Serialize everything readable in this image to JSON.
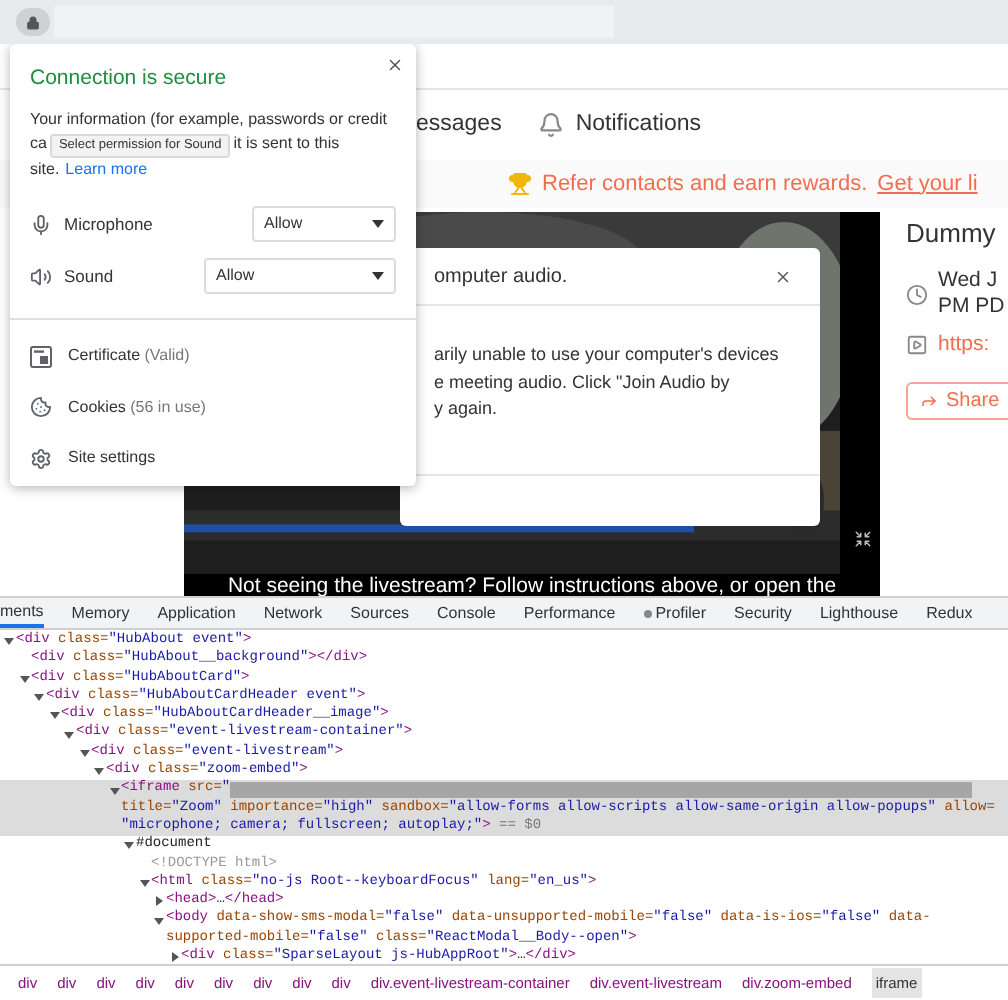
{
  "page": {
    "nav": [
      {
        "kind": "plain",
        "label": "essages"
      },
      {
        "kind": "bell",
        "label": "Notifications"
      }
    ],
    "banner": {
      "text": "Refer contacts and earn rewards.",
      "link": "Get your li"
    },
    "audio_modal": {
      "title": "omputer audio.",
      "body_lines": [
        "arily unable to use your computer's devices",
        "e meeting audio. Click \"Join Audio by",
        "y again."
      ]
    },
    "video": {
      "caption": "Not seeing the livestream? Follow instructions above, or open the"
    },
    "event": {
      "title": "Dummy",
      "date_lines": [
        "Wed J",
        "PM PD"
      ],
      "link": "https:",
      "share": "Share"
    }
  },
  "site_info_popup": {
    "title": "Connection is secure",
    "description": {
      "line_1": "Your information (for example, passwords or credit",
      "line_2_start": "ca",
      "line_2_end": "it is sent to this",
      "line_3": "site."
    },
    "learn_more": "Learn more",
    "tooltip": "Select permission for Sound",
    "permissions": [
      {
        "kind": "microphone",
        "label": "Microphone",
        "value": "Allow"
      },
      {
        "kind": "sound",
        "label": "Sound",
        "value": "Allow"
      }
    ],
    "items": [
      {
        "kind": "certificate",
        "label": "Certificate",
        "detail": "(Valid)"
      },
      {
        "kind": "cookies",
        "label": "Cookies",
        "detail": "(56 in use)"
      },
      {
        "kind": "settings",
        "label": "Site settings"
      }
    ]
  },
  "devtools": {
    "tabs": [
      {
        "kind": "plain",
        "label": "ments",
        "selected": true
      },
      {
        "kind": "plain",
        "label": "Memory",
        "selected": false
      },
      {
        "kind": "plain",
        "label": "Application",
        "selected": false
      },
      {
        "kind": "plain",
        "label": "Network",
        "selected": false
      },
      {
        "kind": "plain",
        "label": "Sources",
        "selected": false
      },
      {
        "kind": "plain",
        "label": "Console",
        "selected": false
      },
      {
        "kind": "plain",
        "label": "Performance",
        "selected": false
      },
      {
        "kind": "extension",
        "label": "Profiler",
        "selected": false
      },
      {
        "kind": "plain",
        "label": "Security",
        "selected": false
      },
      {
        "kind": "plain",
        "label": "Lighthouse",
        "selected": false
      },
      {
        "kind": "plain",
        "label": "Redux",
        "selected": false
      }
    ],
    "tree": [
      {
        "kind": "node",
        "expanded": true,
        "selected": false,
        "lines": [
          [
            {
              "kind": "tag",
              "text": "<div "
            },
            {
              "kind": "attr",
              "text": "class="
            },
            {
              "kind": "value",
              "text": "\"HubAbout event\""
            },
            {
              "kind": "tag",
              "text": ">"
            }
          ]
        ],
        "children": [
          {
            "kind": "leaf",
            "selected": false,
            "lines": [
              [
                {
                  "kind": "tag",
                  "text": "<div "
                },
                {
                  "kind": "attr",
                  "text": "class="
                },
                {
                  "kind": "value",
                  "text": "\"HubAbout__background\""
                },
                {
                  "kind": "tag",
                  "text": "></div>"
                }
              ]
            ]
          },
          {
            "kind": "node",
            "expanded": true,
            "selected": false,
            "lines": [
              [
                {
                  "kind": "tag",
                  "text": "<div "
                },
                {
                  "kind": "attr",
                  "text": "class="
                },
                {
                  "kind": "value",
                  "text": "\"HubAboutCard\""
                },
                {
                  "kind": "tag",
                  "text": ">"
                }
              ]
            ],
            "children": [
              {
                "kind": "node",
                "expanded": true,
                "selected": false,
                "lines": [
                  [
                    {
                      "kind": "tag",
                      "text": "<div "
                    },
                    {
                      "kind": "attr",
                      "text": "class="
                    },
                    {
                      "kind": "value",
                      "text": "\"HubAboutCardHeader event\""
                    },
                    {
                      "kind": "tag",
                      "text": ">"
                    }
                  ]
                ],
                "children": [
                  {
                    "kind": "node",
                    "expanded": true,
                    "selected": false,
                    "lines": [
                      [
                        {
                          "kind": "tag",
                          "text": "<div "
                        },
                        {
                          "kind": "attr",
                          "text": "class="
                        },
                        {
                          "kind": "value",
                          "text": "\"HubAboutCardHeader__image\""
                        },
                        {
                          "kind": "tag",
                          "text": ">"
                        }
                      ]
                    ],
                    "children": [
                      {
                        "kind": "node",
                        "expanded": true,
                        "selected": false,
                        "lines": [
                          [
                            {
                              "kind": "tag",
                              "text": "<div "
                            },
                            {
                              "kind": "attr",
                              "text": "class="
                            },
                            {
                              "kind": "value",
                              "text": "\"event-livestream-container\""
                            },
                            {
                              "kind": "tag",
                              "text": ">"
                            }
                          ]
                        ],
                        "children": [
                          {
                            "kind": "node",
                            "expanded": true,
                            "selected": false,
                            "lines": [
                              [
                                {
                                  "kind": "tag",
                                  "text": "<div "
                                },
                                {
                                  "kind": "attr",
                                  "text": "class="
                                },
                                {
                                  "kind": "value",
                                  "text": "\"event-livestream\""
                                },
                                {
                                  "kind": "tag",
                                  "text": ">"
                                }
                              ]
                            ],
                            "children": [
                              {
                                "kind": "node",
                                "expanded": true,
                                "selected": false,
                                "lines": [
                                  [
                                    {
                                      "kind": "tag",
                                      "text": "<div "
                                    },
                                    {
                                      "kind": "attr",
                                      "text": "class="
                                    },
                                    {
                                      "kind": "value",
                                      "text": "\"zoom-embed\""
                                    },
                                    {
                                      "kind": "tag",
                                      "text": ">"
                                    }
                                  ]
                                ],
                                "children": [
                                  {
                                    "kind": "node",
                                    "expanded": true,
                                    "selected": true,
                                    "lines": [
                                      [
                                        {
                                          "kind": "tag",
                                          "text": "<iframe "
                                        },
                                        {
                                          "kind": "attr",
                                          "text": "src="
                                        },
                                        {
                                          "kind": "value",
                                          "text": "\""
                                        },
                                        {
                                          "kind": "redacted"
                                        }
                                      ],
                                      [
                                        {
                                          "kind": "attr",
                                          "text": "title="
                                        },
                                        {
                                          "kind": "value",
                                          "text": "\"Zoom\" "
                                        },
                                        {
                                          "kind": "attr",
                                          "text": "importance="
                                        },
                                        {
                                          "kind": "value",
                                          "text": "\"high\" "
                                        },
                                        {
                                          "kind": "attr",
                                          "text": "sandbox="
                                        },
                                        {
                                          "kind": "value",
                                          "text": "\"allow-forms allow-scripts allow-same-origin allow-popups\" "
                                        },
                                        {
                                          "kind": "attr",
                                          "text": "allow="
                                        }
                                      ],
                                      [
                                        {
                                          "kind": "value",
                                          "text": "\"microphone; camera; fullscreen; autoplay;\""
                                        },
                                        {
                                          "kind": "tag",
                                          "text": ">"
                                        },
                                        {
                                          "kind": "muted",
                                          "text": " == $0"
                                        }
                                      ]
                                    ],
                                    "children": [
                                      {
                                        "kind": "node",
                                        "expanded": true,
                                        "selected": false,
                                        "lines": [
                                          [
                                            {
                                              "kind": "plain",
                                              "text": "#document"
                                            }
                                          ]
                                        ],
                                        "children": [
                                          {
                                            "kind": "leaf",
                                            "selected": false,
                                            "lines": [
                                              [
                                                {
                                                  "kind": "comment",
                                                  "text": "<!DOCTYPE html>"
                                                }
                                              ]
                                            ]
                                          },
                                          {
                                            "kind": "node",
                                            "expanded": true,
                                            "selected": false,
                                            "lines": [
                                              [
                                                {
                                                  "kind": "tag",
                                                  "text": "<html "
                                                },
                                                {
                                                  "kind": "attr",
                                                  "text": "class="
                                                },
                                                {
                                                  "kind": "value",
                                                  "text": "\"no-js Root--keyboardFocus\" "
                                                },
                                                {
                                                  "kind": "attr",
                                                  "text": "lang="
                                                },
                                                {
                                                  "kind": "value",
                                                  "text": "\"en_us\""
                                                },
                                                {
                                                  "kind": "tag",
                                                  "text": ">"
                                                }
                                              ]
                                            ],
                                            "children": [
                                              {
                                                "kind": "node",
                                                "expanded": false,
                                                "selected": false,
                                                "lines": [
                                                  [
                                                    {
                                                      "kind": "tag",
                                                      "text": "<head>"
                                                    },
                                                    {
                                                      "kind": "plain",
                                                      "text": "…"
                                                    },
                                                    {
                                                      "kind": "tag",
                                                      "text": "</head>"
                                                    }
                                                  ]
                                                ]
                                              },
                                              {
                                                "kind": "node",
                                                "expanded": true,
                                                "selected": false,
                                                "lines": [
                                                  [
                                                    {
                                                      "kind": "tag",
                                                      "text": "<body "
                                                    },
                                                    {
                                                      "kind": "attr",
                                                      "text": "data-show-sms-modal="
                                                    },
                                                    {
                                                      "kind": "value",
                                                      "text": "\"false\" "
                                                    },
                                                    {
                                                      "kind": "attr",
                                                      "text": "data-unsupported-mobile="
                                                    },
                                                    {
                                                      "kind": "value",
                                                      "text": "\"false\" "
                                                    },
                                                    {
                                                      "kind": "attr",
                                                      "text": "data-is-ios="
                                                    },
                                                    {
                                                      "kind": "value",
                                                      "text": "\"false\" "
                                                    },
                                                    {
                                                      "kind": "attr",
                                                      "text": "data-"
                                                    }
                                                  ],
                                                  [
                                                    {
                                                      "kind": "attr",
                                                      "text": "supported-mobile="
                                                    },
                                                    {
                                                      "kind": "value",
                                                      "text": "\"false\" "
                                                    },
                                                    {
                                                      "kind": "attr",
                                                      "text": "class="
                                                    },
                                                    {
                                                      "kind": "value",
                                                      "text": "\"ReactModal__Body--open\""
                                                    },
                                                    {
                                                      "kind": "tag",
                                                      "text": ">"
                                                    }
                                                  ]
                                                ],
                                                "children": [
                                                  {
                                                    "kind": "node",
                                                    "expanded": false,
                                                    "selected": false,
                                                    "lines": [
                                                      [
                                                        {
                                                          "kind": "tag",
                                                          "text": "<div "
                                                        },
                                                        {
                                                          "kind": "attr",
                                                          "text": "class="
                                                        },
                                                        {
                                                          "kind": "value",
                                                          "text": "\"SparseLayout js-HubAppRoot\""
                                                        },
                                                        {
                                                          "kind": "tag",
                                                          "text": ">"
                                                        },
                                                        {
                                                          "kind": "plain",
                                                          "text": "…"
                                                        },
                                                        {
                                                          "kind": "tag",
                                                          "text": "</div>"
                                                        }
                                                      ]
                                                    ]
                                                  }
                                                ]
                                              }
                                            ]
                                          }
                                        ]
                                      }
                                    ]
                                  }
                                ]
                              }
                            ]
                          }
                        ]
                      }
                    ]
                  }
                ]
              }
            ]
          }
        ]
      }
    ],
    "breadcrumbs": [
      {
        "label": "div",
        "selected": false
      },
      {
        "label": "div",
        "selected": false
      },
      {
        "label": "div",
        "selected": false
      },
      {
        "label": "div",
        "selected": false
      },
      {
        "label": "div",
        "selected": false
      },
      {
        "label": "div",
        "selected": false
      },
      {
        "label": "div",
        "selected": false
      },
      {
        "label": "div",
        "selected": false
      },
      {
        "label": "div",
        "selected": false
      },
      {
        "label": "div.event-livestream-container",
        "selected": false
      },
      {
        "label": "div.event-livestream",
        "selected": false
      },
      {
        "label": "div.zoom-embed",
        "selected": false
      },
      {
        "label": "iframe",
        "selected": true
      }
    ]
  }
}
